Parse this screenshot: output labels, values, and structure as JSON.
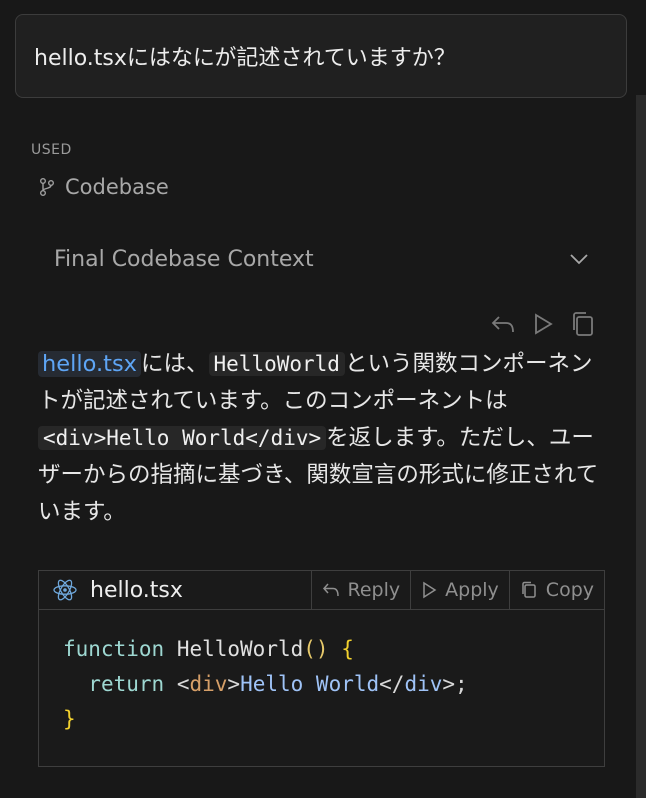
{
  "query": {
    "text": "hello.tsxにはなにが記述されていますか？"
  },
  "used": {
    "label": "USED",
    "source": "Codebase",
    "context_title": "Final Codebase Context"
  },
  "answer": {
    "file_link": "hello.tsx",
    "t1": "には、",
    "code1": "HelloWorld",
    "t2": "という関数コンポーネントが記述されています。このコンポーネントは",
    "code2": "<div>Hello World</div>",
    "t3": "を返します。ただし、ユーザーからの指摘に基づき、関数宣言の形式に修正されています。"
  },
  "code_block": {
    "filename": "hello.tsx",
    "reply_label": "Reply",
    "apply_label": "Apply",
    "copy_label": "Copy",
    "lines": {
      "l1_keyword": "function",
      "l1_name": "HelloWorld",
      "l1_parens": "()",
      "l1_brace": "{",
      "l2_return": "return",
      "l2_open_lt": "<",
      "l2_open_tag": "div",
      "l2_open_gt": ">",
      "l2_text": "Hello World",
      "l2_close_lt": "</",
      "l2_close_tag": "div",
      "l2_close_gt": ">",
      "l2_semicolon": ";",
      "l3_brace": "}"
    }
  },
  "colors": {
    "background": "#181818",
    "link": "#5ea5f5",
    "keyword": "#9ed8d2",
    "brace": "#f2d12e",
    "tag": "#d69f68"
  },
  "icons": [
    "branch-icon",
    "chevron-down-icon",
    "reply-icon",
    "play-icon",
    "copy-icon",
    "react-icon"
  ]
}
